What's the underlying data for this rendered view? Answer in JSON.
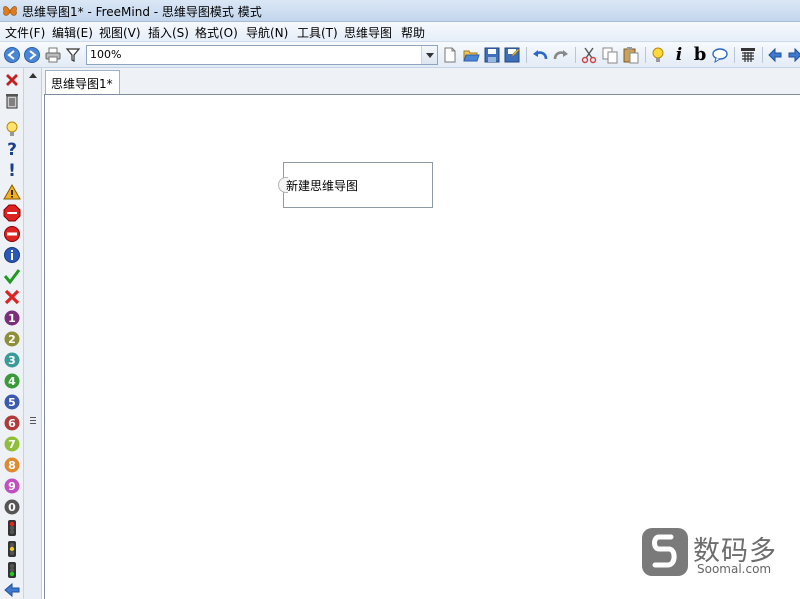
{
  "window": {
    "title": "思维导图1* - FreeMind - 思维导图模式 模式",
    "app_icon": "butterfly-icon"
  },
  "menu": [
    "文件(F)",
    "编辑(E)",
    "视图(V)",
    "插入(S)",
    "格式(O)",
    "导航(N)",
    "工具(T)",
    "思维导图",
    "帮助"
  ],
  "toolbar": {
    "zoom_value": "100%",
    "buttons": [
      "back-icon",
      "forward-icon",
      "print-icon",
      "filter-icon",
      "new-map-icon",
      "open-icon",
      "save-icon",
      "save-as-icon",
      "undo-icon",
      "redo-icon",
      "cut-icon",
      "copy-icon",
      "paste-icon",
      "bulb-icon",
      "italic-icon",
      "bold-icon",
      "note-icon",
      "grid-icon",
      "prev-icon",
      "next-icon"
    ],
    "italic_label": "i",
    "bold_label": "b"
  },
  "iconbar": {
    "icons": [
      "remove-icon",
      "trash-icon",
      "idea-icon",
      "question-icon",
      "important-icon",
      "warning-icon",
      "stop-icon",
      "minus-icon",
      "info-icon",
      "check-icon",
      "cross-icon",
      "number-1-icon",
      "number-2-icon",
      "number-3-icon",
      "number-4-icon",
      "number-5-icon",
      "number-6-icon",
      "number-7-icon",
      "number-8-icon",
      "number-9-icon",
      "number-0-icon",
      "traffic-light-red-icon",
      "traffic-light-yellow-icon",
      "traffic-light-green-icon",
      "back-arrow-icon"
    ],
    "numbers": [
      "1",
      "2",
      "3",
      "4",
      "5",
      "6",
      "7",
      "8",
      "9",
      "0"
    ],
    "number_colors": [
      "#7b2f7b",
      "#8f8f3a",
      "#3a9a9a",
      "#3a9a3a",
      "#3a5ab0",
      "#b03a3a",
      "#8fbf3a",
      "#e08a30",
      "#c050c0",
      "#555555"
    ]
  },
  "tabs": [
    {
      "label": "思维导图1*"
    }
  ],
  "map": {
    "root_node": "新建思维导图"
  },
  "watermark": {
    "cn": "数码多",
    "en": "Soomal.com"
  },
  "colors": {
    "titlebar": "#c3d6ee",
    "canvas": "#ffffff",
    "node_border": "#909aa5"
  }
}
